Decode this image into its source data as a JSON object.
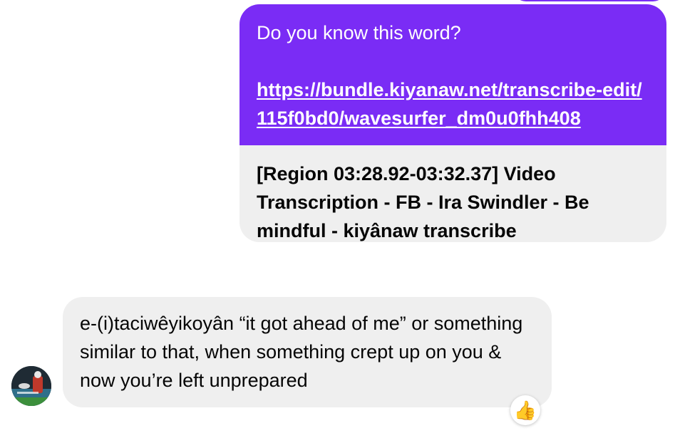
{
  "outgoing_message": {
    "text": "Do you know this word?",
    "link": "https://bundle.kiyanaw.net/transcribe-edit/115f0bd0/wavesurfer_dm0u0fhh408",
    "preview_title": "[Region 03:28.92-03:32.37] Video Transcription - FB - Ira Swindler - Be mindful - kiyânaw transcribe"
  },
  "incoming_message": {
    "text": "e-(i)taciwêyikoyân “it got ahead of me” or something similar to that, when something crept up on you & now you’re left unprepared",
    "reaction": "👍"
  },
  "colors": {
    "outgoing_bubble": "#7a2cf5",
    "incoming_bubble": "#efefef",
    "preview_bubble": "#efefef"
  },
  "icons": {
    "avatar": "user-avatar",
    "reaction": "thumbs-up-icon"
  }
}
